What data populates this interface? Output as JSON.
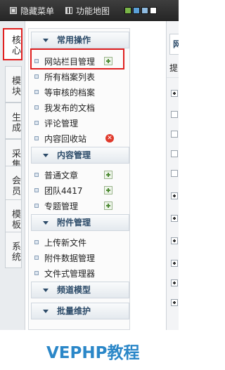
{
  "topbar": {
    "hide_menu_label": "隐藏菜单",
    "site_map_label": "功能地图",
    "theme_swatches": [
      "#7ab648",
      "#5aa0d8",
      "#8fbbe0",
      "#ffffff"
    ]
  },
  "left_tabs": [
    "核心",
    "模块",
    "生成",
    "采集",
    "会员",
    "模板",
    "系统"
  ],
  "menu": {
    "sections": [
      {
        "title": "常用操作",
        "items": [
          "网站栏目管理",
          "所有档案列表",
          "等审核的档案",
          "我发布的文档",
          "评论管理",
          "内容回收站"
        ]
      },
      {
        "title": "内容管理",
        "items": [
          "普通文章",
          "团队4417",
          "专题管理"
        ]
      },
      {
        "title": "附件管理",
        "items": [
          "上传新文件",
          "附件数据管理",
          "文件式管理器"
        ]
      },
      {
        "title": "频道模型",
        "items": []
      },
      {
        "title": "批量维护",
        "items": []
      }
    ]
  },
  "right_panel": {
    "tab_label": "网",
    "submit_label": "提"
  },
  "watermark": "VEPHP教程",
  "colors": {
    "highlight": "#e02020",
    "section_text": "#2b4a68",
    "watermark": "#2b87c8"
  }
}
